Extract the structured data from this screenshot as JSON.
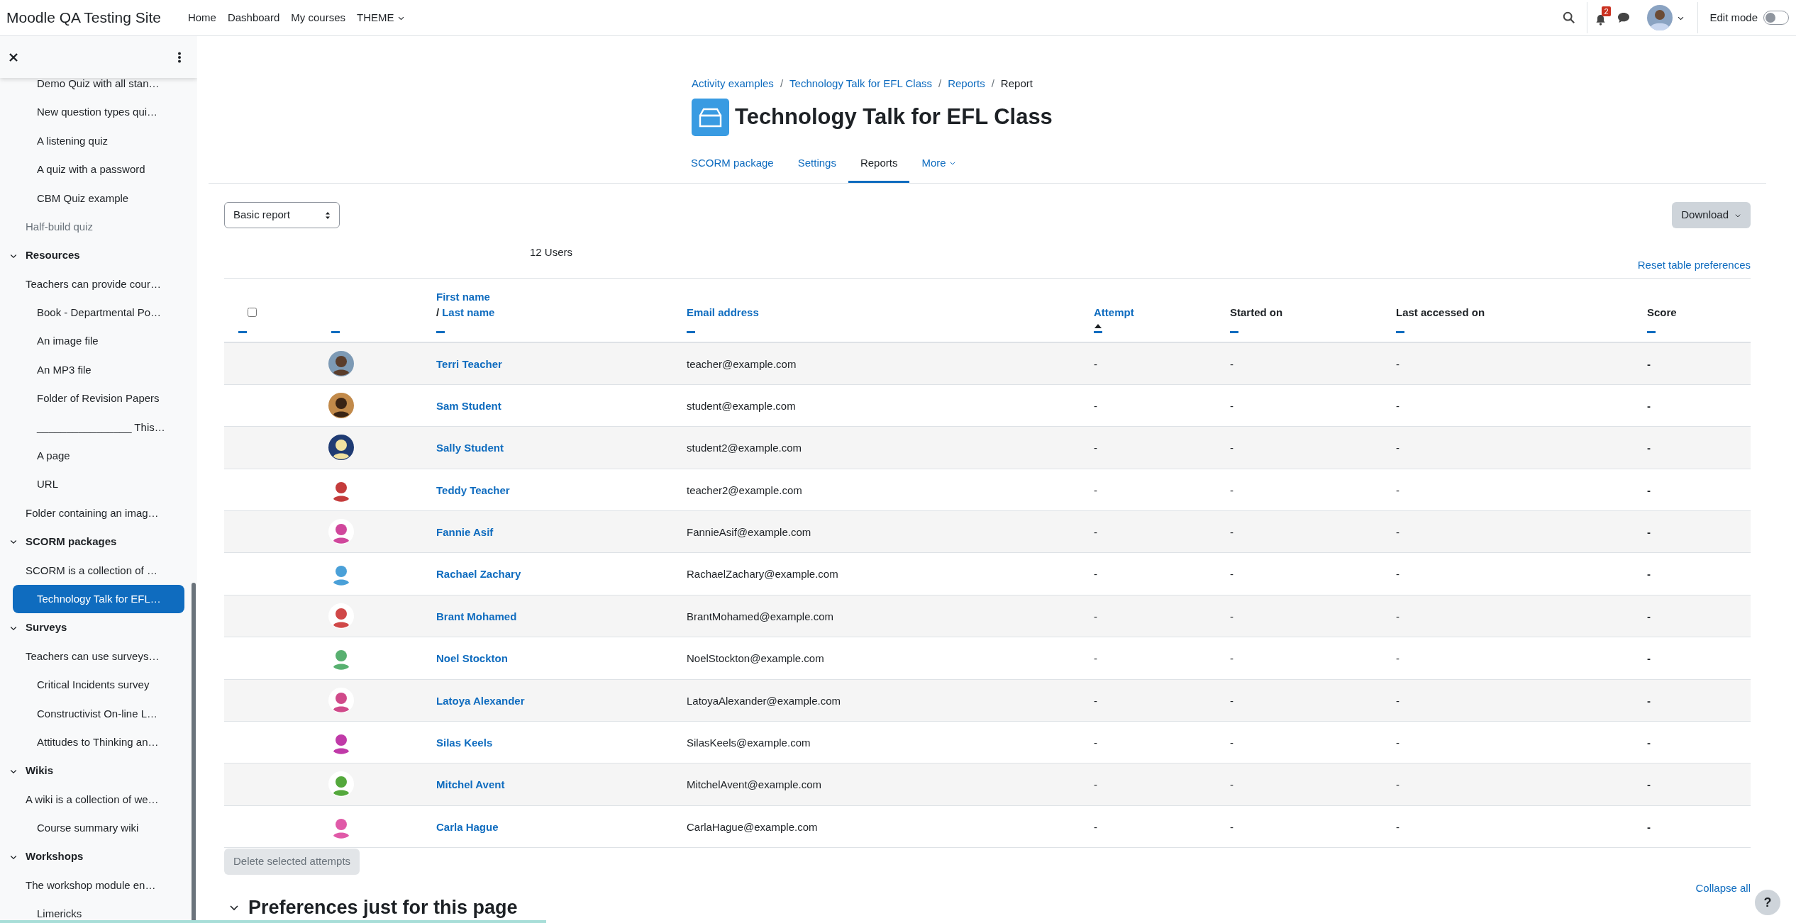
{
  "navbar": {
    "brand": "Moodle QA Testing Site",
    "links": [
      {
        "label": "Home",
        "dropdown": false
      },
      {
        "label": "Dashboard",
        "dropdown": false
      },
      {
        "label": "My courses",
        "dropdown": false
      },
      {
        "label": "THEME",
        "dropdown": true
      }
    ],
    "notification_count": "2",
    "edit_mode": {
      "label": "Edit mode",
      "on": false
    }
  },
  "course_index": {
    "partial": [
      {
        "children": [
          {
            "label": "Demo Quiz with all stan…",
            "selected": false,
            "dimmed": false
          },
          {
            "label": "New question types qui…",
            "selected": false,
            "dimmed": false
          },
          {
            "label": "A listening quiz",
            "selected": false,
            "dimmed": false
          },
          {
            "label": "A quiz with a password",
            "selected": false,
            "dimmed": false
          },
          {
            "label": "CBM Quiz example",
            "selected": false,
            "dimmed": false
          }
        ]
      },
      {
        "label": "Half-build quiz",
        "selected": false,
        "dimmed": true
      }
    ],
    "sections": [
      {
        "title": "Resources",
        "expanded": true,
        "items": [
          {
            "label": "Teachers can provide cour…",
            "selected": false,
            "dimmed": false,
            "children": [
              {
                "label": "Book - Departmental Po…",
                "selected": false,
                "dimmed": false
              },
              {
                "label": "An image file",
                "selected": false,
                "dimmed": false
              },
              {
                "label": "An MP3 file",
                "selected": false,
                "dimmed": false
              },
              {
                "label": "Folder of Revision Papers",
                "selected": false,
                "dimmed": false
              },
              {
                "label": "________________ This…",
                "selected": false,
                "dimmed": false
              },
              {
                "label": "A page",
                "selected": false,
                "dimmed": false
              },
              {
                "label": "URL",
                "selected": false,
                "dimmed": false
              }
            ]
          },
          {
            "label": "Folder containing an imag…",
            "selected": false,
            "dimmed": false
          }
        ]
      },
      {
        "title": "SCORM packages",
        "expanded": true,
        "items": [
          {
            "label": "SCORM is a collection of …",
            "selected": false,
            "dimmed": false,
            "children": [
              {
                "label": "Technology Talk for EFL…",
                "selected": true,
                "dimmed": false
              }
            ]
          }
        ]
      },
      {
        "title": "Surveys",
        "expanded": true,
        "items": [
          {
            "label": "Teachers can use surveys…",
            "selected": false,
            "dimmed": false,
            "children": [
              {
                "label": "Critical Incidents survey",
                "selected": false,
                "dimmed": false
              },
              {
                "label": "Constructivist On-line L…",
                "selected": false,
                "dimmed": false
              },
              {
                "label": "Attitudes to Thinking an…",
                "selected": false,
                "dimmed": false
              }
            ]
          }
        ]
      },
      {
        "title": "Wikis",
        "expanded": true,
        "items": [
          {
            "label": "A wiki is a collection of we…",
            "selected": false,
            "dimmed": false,
            "children": [
              {
                "label": "Course summary wiki",
                "selected": false,
                "dimmed": false
              }
            ]
          }
        ]
      },
      {
        "title": "Workshops",
        "expanded": true,
        "items": [
          {
            "label": "The workshop module en…",
            "selected": false,
            "dimmed": false,
            "children": [
              {
                "label": "Limericks",
                "selected": false,
                "dimmed": false
              }
            ]
          }
        ]
      }
    ]
  },
  "breadcrumb": {
    "separator": "/",
    "items": [
      {
        "label": "Activity examples",
        "current": false
      },
      {
        "label": "Technology Talk for EFL Class",
        "current": false
      },
      {
        "label": "Reports",
        "current": false
      },
      {
        "label": "Report",
        "current": true
      }
    ]
  },
  "title": "Technology Talk for EFL Class",
  "tabs": [
    {
      "label": "SCORM package",
      "selected": false,
      "dropdown": false
    },
    {
      "label": "Settings",
      "selected": false,
      "dropdown": false
    },
    {
      "label": "Reports",
      "selected": true,
      "dropdown": false
    },
    {
      "label": "More",
      "selected": false,
      "dropdown": true
    }
  ],
  "report_select": {
    "value": "Basic report"
  },
  "download_button": "Download",
  "user_count": "12 Users",
  "reset_link": "Reset table preferences",
  "table": {
    "columns": [
      {
        "kind": "checkbox",
        "checked": false,
        "sorted": false
      },
      {
        "kind": "blank",
        "sorted": false
      },
      {
        "kind": "name",
        "first": "First name",
        "separator": "/",
        "last": "Last name",
        "sorted": false
      },
      {
        "kind": "link",
        "label": "Email address",
        "sorted": false
      },
      {
        "kind": "link",
        "label": "Attempt",
        "sorted": true
      },
      {
        "kind": "plain",
        "label": "Started on",
        "sorted": false
      },
      {
        "kind": "plain",
        "label": "Last accessed on",
        "sorted": false
      },
      {
        "kind": "plain",
        "label": "Score",
        "sorted": false
      }
    ],
    "rows": [
      {
        "name": "Terri Teacher",
        "email": "teacher@example.com",
        "attempt": "-",
        "started": "-",
        "last_accessed": "-",
        "score": "-",
        "checked": false
      },
      {
        "name": "Sam Student",
        "email": "student@example.com",
        "attempt": "-",
        "started": "-",
        "last_accessed": "-",
        "score": "-",
        "checked": false
      },
      {
        "name": "Sally Student",
        "email": "student2@example.com",
        "attempt": "-",
        "started": "-",
        "last_accessed": "-",
        "score": "-",
        "checked": false
      },
      {
        "name": "Teddy Teacher",
        "email": "teacher2@example.com",
        "attempt": "-",
        "started": "-",
        "last_accessed": "-",
        "score": "-",
        "checked": false
      },
      {
        "name": "Fannie Asif",
        "email": "FannieAsif@example.com",
        "attempt": "-",
        "started": "-",
        "last_accessed": "-",
        "score": "-",
        "checked": false
      },
      {
        "name": "Rachael Zachary",
        "email": "RachaelZachary@example.com",
        "attempt": "-",
        "started": "-",
        "last_accessed": "-",
        "score": "-",
        "checked": false
      },
      {
        "name": "Brant Mohamed",
        "email": "BrantMohamed@example.com",
        "attempt": "-",
        "started": "-",
        "last_accessed": "-",
        "score": "-",
        "checked": false
      },
      {
        "name": "Noel Stockton",
        "email": "NoelStockton@example.com",
        "attempt": "-",
        "started": "-",
        "last_accessed": "-",
        "score": "-",
        "checked": false
      },
      {
        "name": "Latoya Alexander",
        "email": "LatoyaAlexander@example.com",
        "attempt": "-",
        "started": "-",
        "last_accessed": "-",
        "score": "-",
        "checked": false
      },
      {
        "name": "Silas Keels",
        "email": "SilasKeels@example.com",
        "attempt": "-",
        "started": "-",
        "last_accessed": "-",
        "score": "-",
        "checked": false
      },
      {
        "name": "Mitchel Avent",
        "email": "MitchelAvent@example.com",
        "attempt": "-",
        "started": "-",
        "last_accessed": "-",
        "score": "-",
        "checked": false
      },
      {
        "name": "Carla Hague",
        "email": "CarlaHague@example.com",
        "attempt": "-",
        "started": "-",
        "last_accessed": "-",
        "score": "-",
        "checked": false
      }
    ]
  },
  "delete_button": {
    "label": "Delete selected attempts",
    "disabled": true
  },
  "collapse_all": "Collapse all",
  "help_button": "?",
  "preferences": {
    "title": "Preferences just for this page",
    "expanded": true
  }
}
